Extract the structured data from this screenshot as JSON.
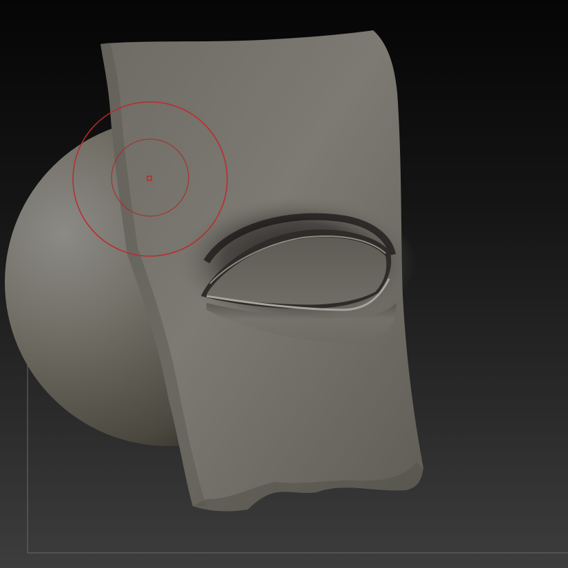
{
  "app": {
    "name": "",
    "viewport_label": ""
  },
  "scene": {
    "objects": [
      {
        "name": "sphere",
        "shading": "matcap-grey"
      },
      {
        "name": "sculpted-eye-mesh",
        "shading": "matcap-grey"
      }
    ],
    "brush": {
      "cursor_style": "draw-size-rings",
      "color": "#c0282a"
    }
  },
  "colors": {
    "background_top": "#050505",
    "background_bottom": "#3b3b3b",
    "mesh_base": "#76746a",
    "brush_ring": "#c0282a"
  }
}
